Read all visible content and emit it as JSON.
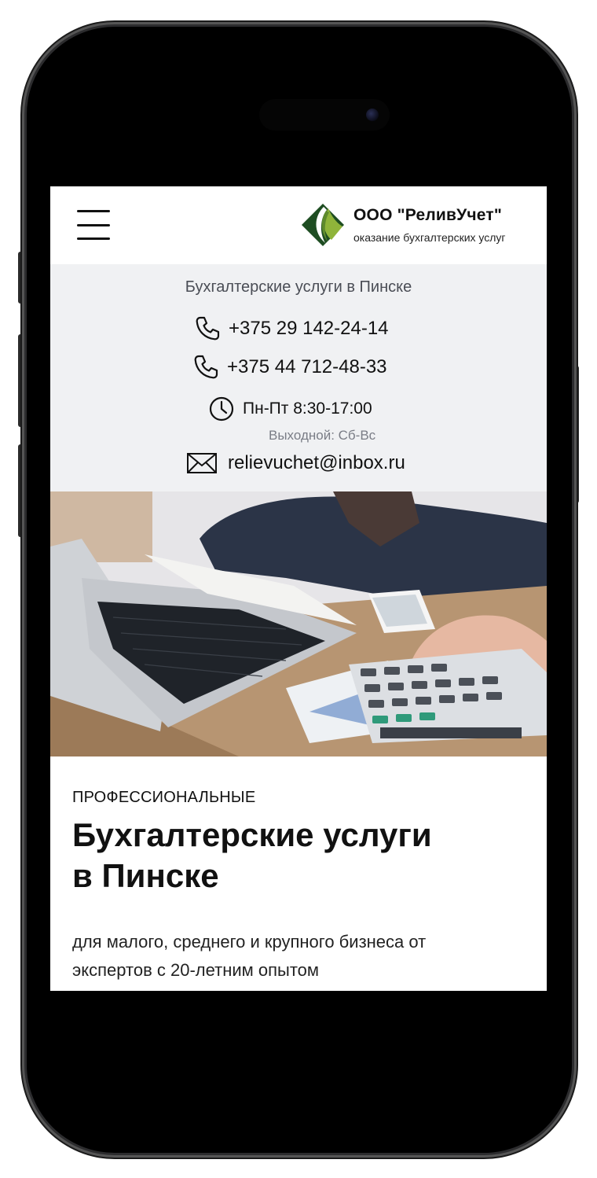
{
  "header": {
    "company_name": "ООО \"РеливУчет\"",
    "company_tagline": "оказание бухгалтерских услуг"
  },
  "contacts": {
    "tagline": "Бухгалтерские услуги в Пинске",
    "phone_1": "+375 29 142-24-14",
    "phone_2": "+375 44 712-48-33",
    "hours": "Пн-Пт 8:30-17:00",
    "weekend": "Выходной: Сб-Вс",
    "email": "relievuchet@inbox.ru"
  },
  "hero": {
    "eyebrow": "ПРОФЕССИОНАЛЬНЫЕ",
    "title_line1": "Бухгалтерские услуги",
    "title_line2": "в Пинске",
    "description_line1": "для малого, среднего и крупного бизнеса от",
    "description_line2": "экспертов с 20-летним опытом"
  },
  "colors": {
    "logo_dark_green": "#1e4d22",
    "logo_light_green": "#8fb43a",
    "contacts_bg": "#f0f1f3"
  },
  "icons": [
    "menu-icon",
    "logo-mark",
    "phone-icon",
    "phone-icon",
    "clock-icon",
    "mail-icon"
  ]
}
